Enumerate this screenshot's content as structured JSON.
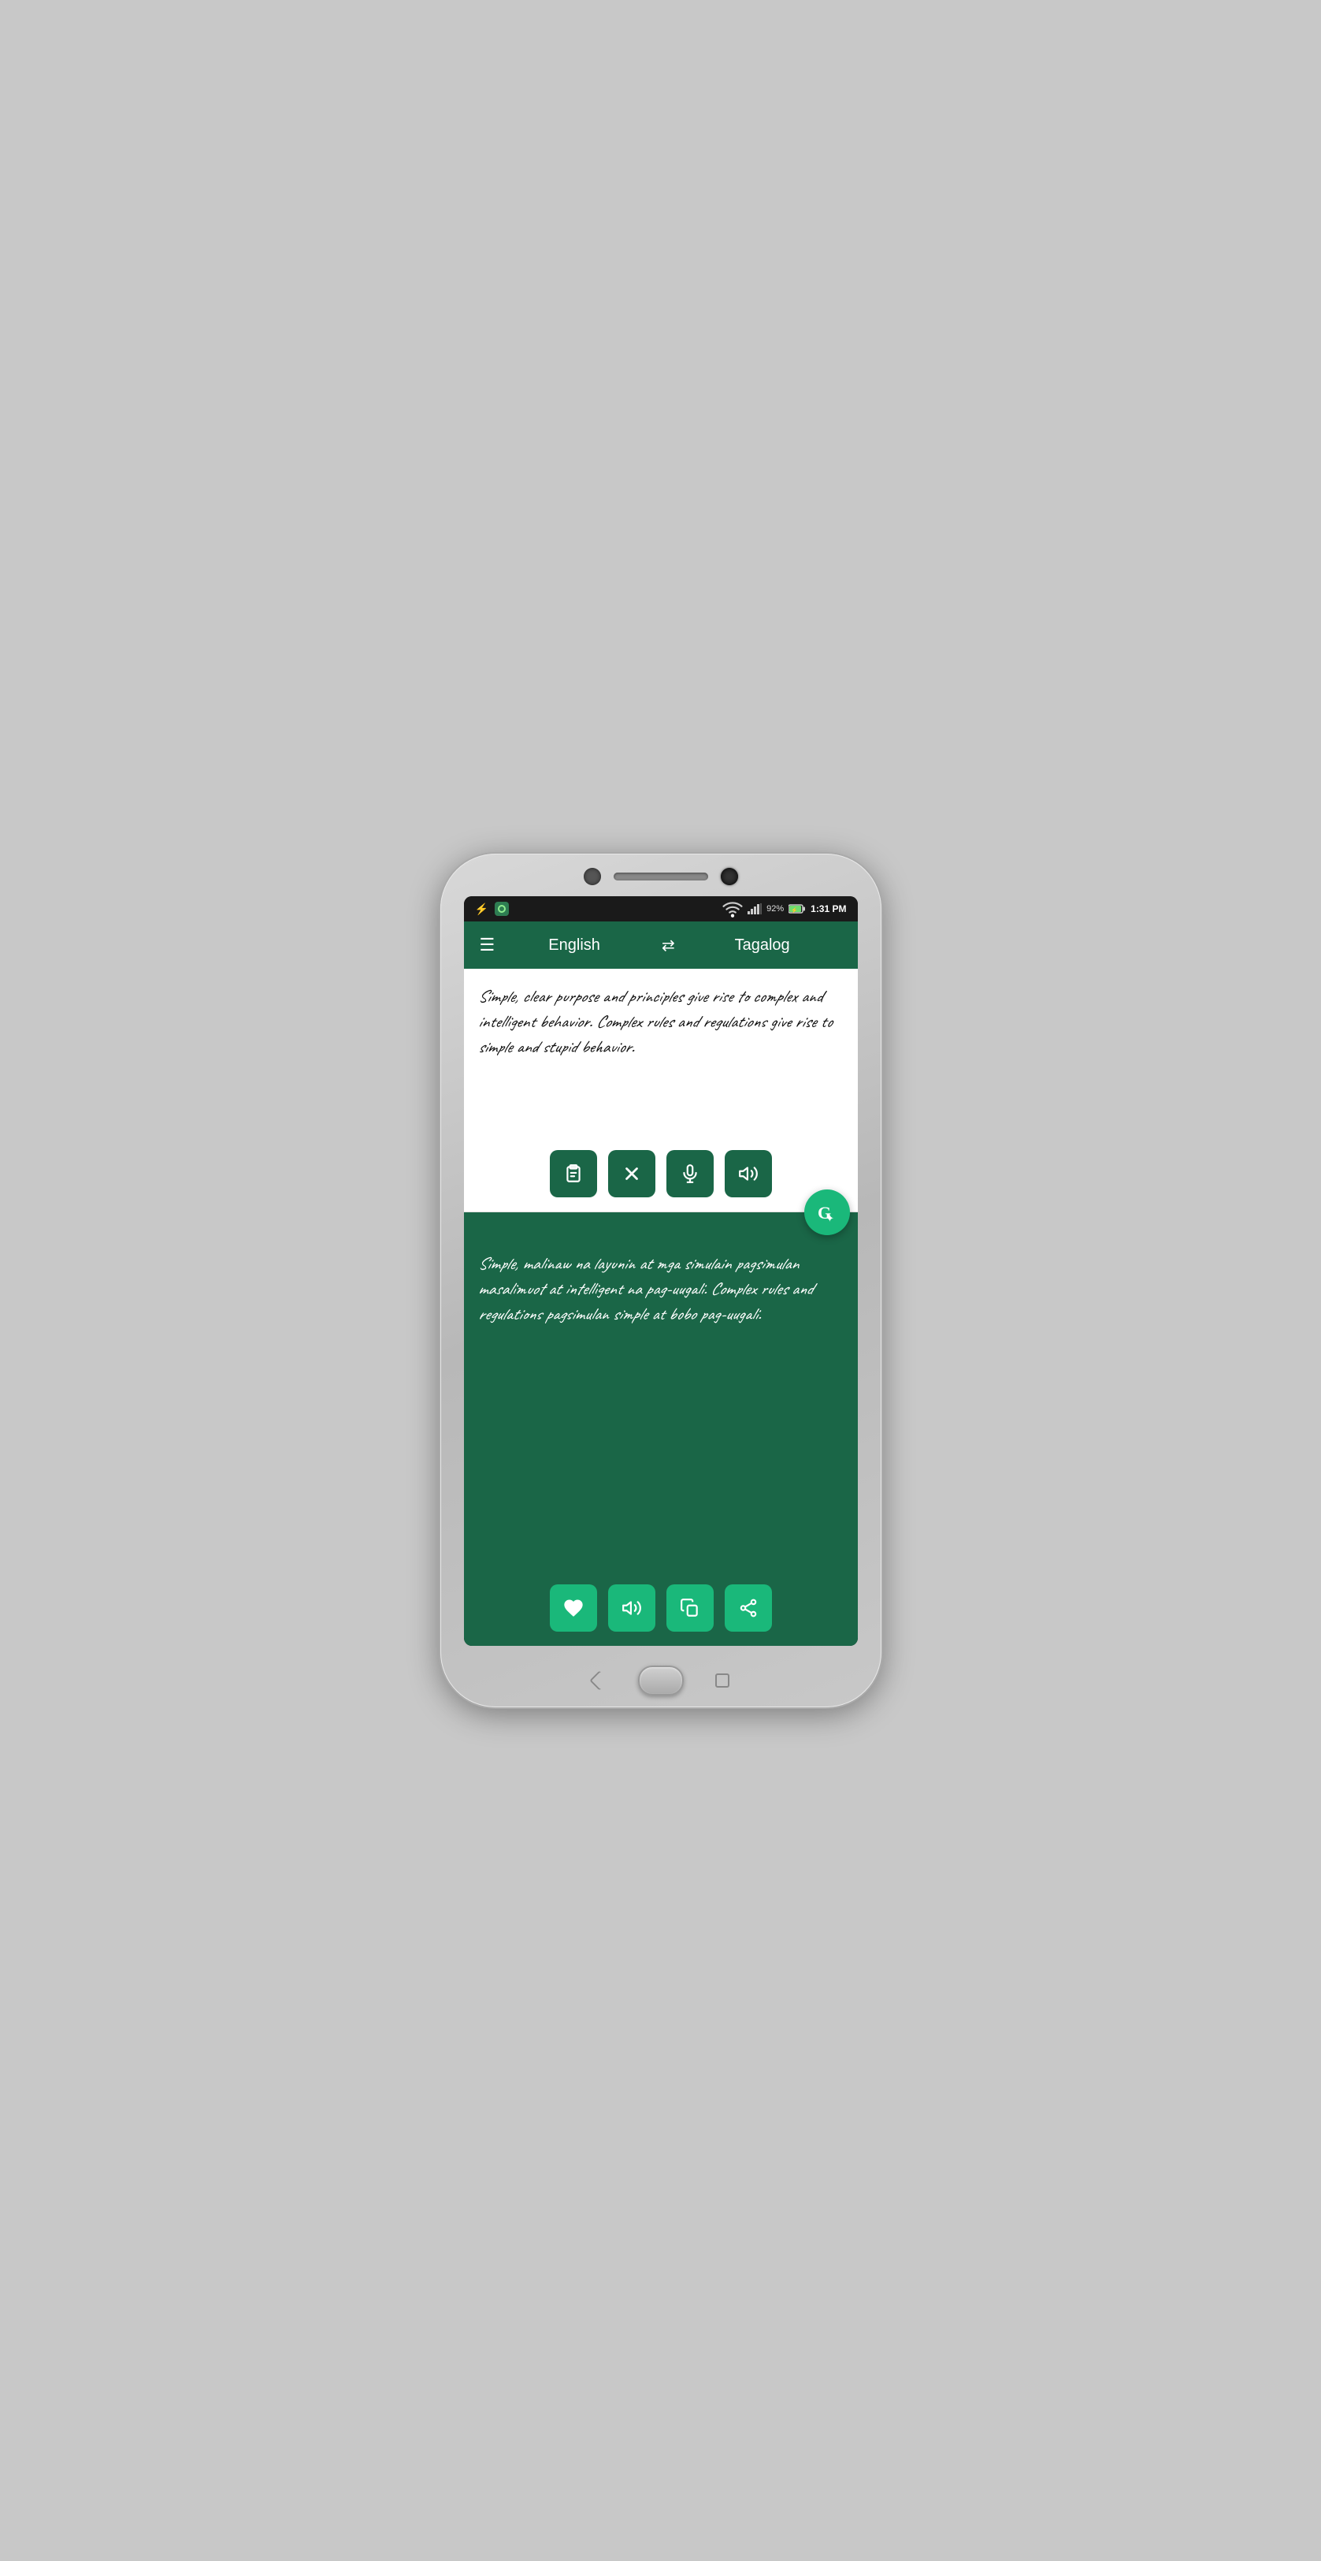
{
  "phone": {
    "status_bar": {
      "time": "1:31 PM",
      "battery": "92%",
      "usb_symbol": "⚡",
      "wifi": "WiFi",
      "signal": "Signal"
    },
    "toolbar": {
      "menu_icon": "☰",
      "lang_from": "English",
      "swap_icon": "⇄",
      "lang_to": "Tagalog"
    },
    "input": {
      "text": "Simple, clear purpose and principles give rise to complex and intelligent behavior. Complex rules and regulations give rise to simple and stupid behavior.",
      "btn_clipboard": "clipboard",
      "btn_clear": "clear",
      "btn_mic": "mic",
      "btn_speaker": "speaker"
    },
    "output": {
      "text": "Simple, malinaw na layunin at mga simulain pagsimulan masalimuot at intelligent na pag-uugali. Complex rules and regulations pagsimulan simple at bobo pag-uugali.",
      "btn_favorite": "favorite",
      "btn_speaker": "speaker",
      "btn_copy": "copy",
      "btn_share": "share"
    },
    "gtranslate_label": "G"
  }
}
